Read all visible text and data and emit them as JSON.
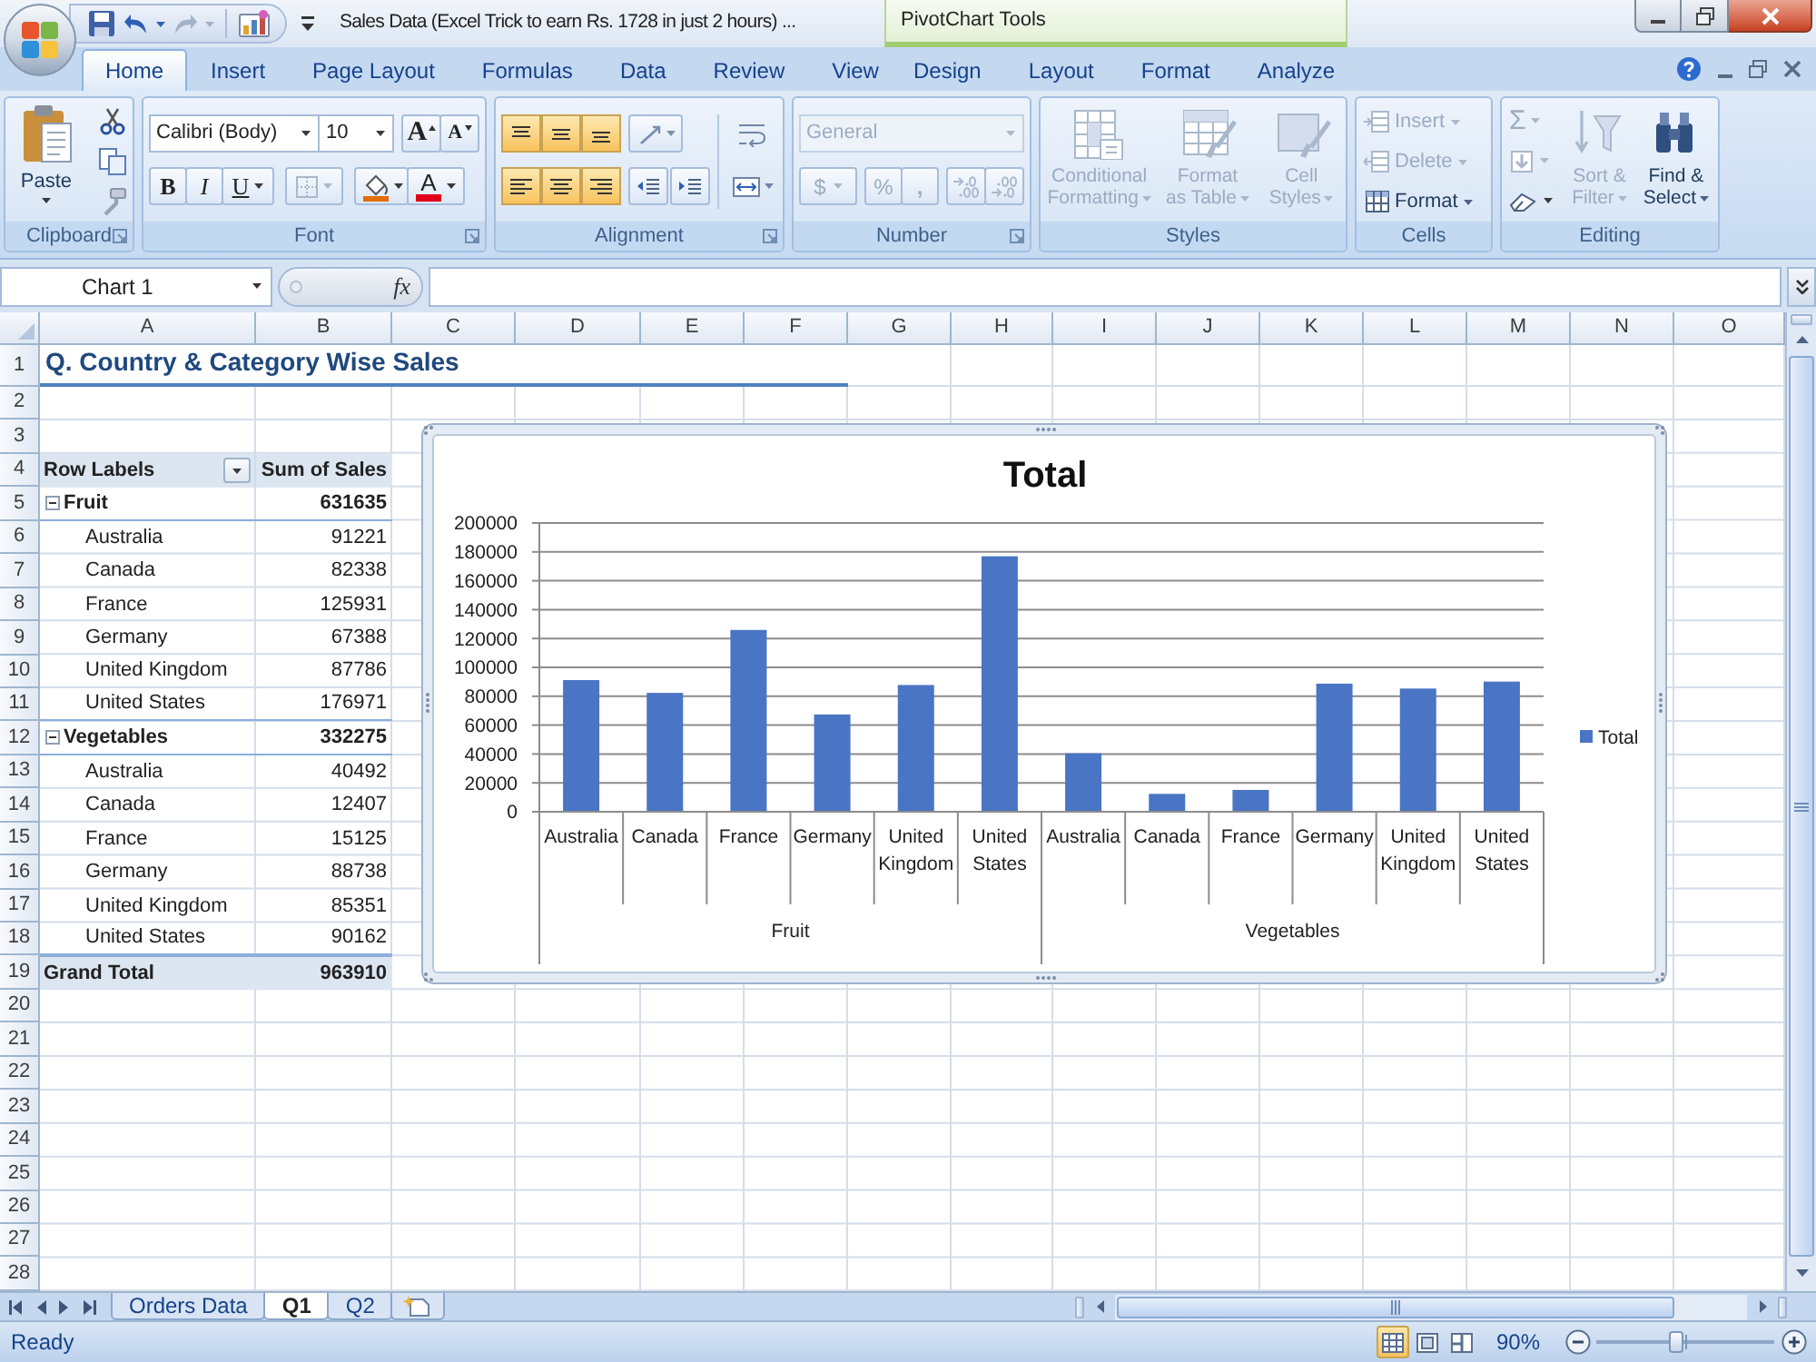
{
  "title_bar": {
    "title": "Sales Data (Excel Trick to earn Rs. 1728 in just 2 hours) ...",
    "context_label": "PivotChart Tools"
  },
  "quick_access": {
    "undo": {
      "disabled": false
    },
    "redo": {
      "disabled": true
    }
  },
  "tabs": [
    {
      "label": "Home",
      "selected": true
    },
    {
      "label": "Insert",
      "selected": false
    },
    {
      "label": "Page Layout",
      "selected": false
    },
    {
      "label": "Formulas",
      "selected": false
    },
    {
      "label": "Data",
      "selected": false
    },
    {
      "label": "Review",
      "selected": false
    },
    {
      "label": "View",
      "selected": false
    }
  ],
  "context_tabs": [
    {
      "label": "Design",
      "selected": false
    },
    {
      "label": "Layout",
      "selected": false
    },
    {
      "label": "Format",
      "selected": false
    },
    {
      "label": "Analyze",
      "selected": false
    }
  ],
  "ribbon": {
    "clipboard": {
      "label": "Clipboard",
      "paste": "Paste"
    },
    "font": {
      "label": "Font",
      "font_name": "Calibri (Body)",
      "font_size": "10",
      "grow_glyph": "A",
      "shrink_glyph": "A",
      "bold_glyph": "B",
      "italic_glyph": "I",
      "underline_glyph": "U",
      "color_glyph": "A",
      "borders_disabled": true
    },
    "alignment": {
      "label": "Alignment",
      "buttons": [
        {
          "kind": "top",
          "highlighted": true
        },
        {
          "kind": "middle",
          "highlighted": true
        },
        {
          "kind": "bottom",
          "highlighted": true
        },
        {
          "kind": "left",
          "highlighted": true
        },
        {
          "kind": "center",
          "highlighted": true
        },
        {
          "kind": "right",
          "highlighted": true
        }
      ]
    },
    "number": {
      "label": "Number",
      "format": "General",
      "disabled": true,
      "currency_glyph": "$",
      "percent_glyph": "%",
      "comma_glyph": ","
    },
    "styles": {
      "label": "Styles",
      "buttons": [
        {
          "kind": "conditional",
          "label": "Conditional Formatting",
          "disabled": true
        },
        {
          "kind": "table",
          "label": "Format as Table",
          "disabled": true
        },
        {
          "kind": "cell",
          "label": "Cell Styles",
          "disabled": true
        }
      ]
    },
    "cells": {
      "label": "Cells",
      "buttons": [
        {
          "kind": "insert",
          "label": "Insert",
          "disabled": true
        },
        {
          "kind": "delete",
          "label": "Delete",
          "disabled": true
        },
        {
          "kind": "format",
          "label": "Format",
          "disabled": false
        }
      ]
    },
    "editing": {
      "label": "Editing",
      "sum_glyph": "Σ",
      "sum_disabled": true,
      "fill_disabled": true,
      "buttons": [
        {
          "kind": "sort",
          "label": "Sort & Filter",
          "disabled": true
        },
        {
          "kind": "find",
          "label": "Find & Select",
          "disabled": false
        }
      ]
    }
  },
  "formula_bar": {
    "name_box": "Chart 1",
    "function_label": "fx"
  },
  "sheet": {
    "columns": [
      "A",
      "B",
      "C",
      "D",
      "E",
      "F",
      "G",
      "H",
      "I",
      "J",
      "K",
      "L",
      "M",
      "N",
      "O"
    ],
    "rows": [
      "1",
      "2",
      "3",
      "4",
      "5",
      "6",
      "7",
      "8",
      "9",
      "10",
      "11",
      "12",
      "13",
      "14",
      "15",
      "16",
      "17",
      "18",
      "19",
      "20",
      "21",
      "22",
      "23",
      "24",
      "25",
      "26",
      "27",
      "28"
    ],
    "title": "Q. Country & Category Wise Sales"
  },
  "pivot_table": {
    "row_labels_header": "Row Labels",
    "values_header": "Sum of Sales",
    "groups": [
      {
        "label": "Fruit",
        "total": "631635",
        "expanded": true,
        "children": [
          {
            "label": "Australia",
            "value": "91221"
          },
          {
            "label": "Canada",
            "value": "82338"
          },
          {
            "label": "France",
            "value": "125931"
          },
          {
            "label": "Germany",
            "value": "67388"
          },
          {
            "label": "United Kingdom",
            "value": "87786"
          },
          {
            "label": "United States",
            "value": "176971"
          }
        ]
      },
      {
        "label": "Vegetables",
        "total": "332275",
        "expanded": true,
        "children": [
          {
            "label": "Australia",
            "value": "40492"
          },
          {
            "label": "Canada",
            "value": "12407"
          },
          {
            "label": "France",
            "value": "15125"
          },
          {
            "label": "Germany",
            "value": "88738"
          },
          {
            "label": "United Kingdom",
            "value": "85351"
          },
          {
            "label": "United States",
            "value": "90162"
          }
        ]
      }
    ],
    "grand_total": {
      "label": "Grand Total",
      "value": "963910"
    }
  },
  "chart": {
    "chart_data": {
      "type": "bar",
      "title": "Total",
      "grid": true,
      "categories": [
        "Australia",
        "Canada",
        "France",
        "Germany",
        "United Kingdom",
        "United States",
        "Australia",
        "Canada",
        "France",
        "Germany",
        "United Kingdom",
        "United States"
      ],
      "series": [
        {
          "name": "Total",
          "color": "#4a75c4",
          "values": [
            91221,
            82338,
            125931,
            67388,
            87786,
            176971,
            40492,
            12407,
            15125,
            88738,
            85351,
            90162
          ]
        }
      ],
      "ylim": [
        0,
        200000
      ],
      "yticks": [
        0,
        20000,
        40000,
        60000,
        80000,
        100000,
        120000,
        140000,
        160000,
        180000,
        200000
      ]
    },
    "category_groups": [
      {
        "label": "Fruit"
      },
      {
        "label": "Vegetables"
      }
    ]
  },
  "sheet_tabs": [
    {
      "label": "Orders Data",
      "selected": false
    },
    {
      "label": "Q1",
      "selected": true
    },
    {
      "label": "Q2",
      "selected": false
    }
  ],
  "status_bar": {
    "status": "Ready",
    "views": [
      {
        "kind": "normal",
        "selected": true
      },
      {
        "kind": "page_layout",
        "selected": false
      },
      {
        "kind": "page_break",
        "selected": false
      }
    ],
    "zoom": "90%",
    "zoom_slider": {
      "level": 0.45
    }
  }
}
